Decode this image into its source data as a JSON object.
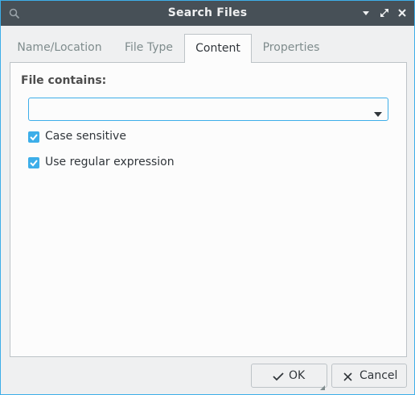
{
  "window": {
    "title": "Search Files"
  },
  "titlebar": {
    "app_icon": "search-icon",
    "buttons": [
      "minimize-icon",
      "maximize-icon",
      "close-icon"
    ]
  },
  "tabs": [
    {
      "label": "Name/Location",
      "active": false
    },
    {
      "label": "File Type",
      "active": false
    },
    {
      "label": "Content",
      "active": true
    },
    {
      "label": "Properties",
      "active": false
    }
  ],
  "content": {
    "heading": "File contains:",
    "search_value": "",
    "case_sensitive": {
      "label": "Case sensitive",
      "checked": true
    },
    "regex": {
      "label": "Use regular expression",
      "checked": true
    }
  },
  "footer": {
    "ok_label": "OK",
    "cancel_label": "Cancel"
  },
  "colors": {
    "accent": "#3daee9",
    "titlebar": "#475057",
    "window_bg": "#eff0f1"
  }
}
